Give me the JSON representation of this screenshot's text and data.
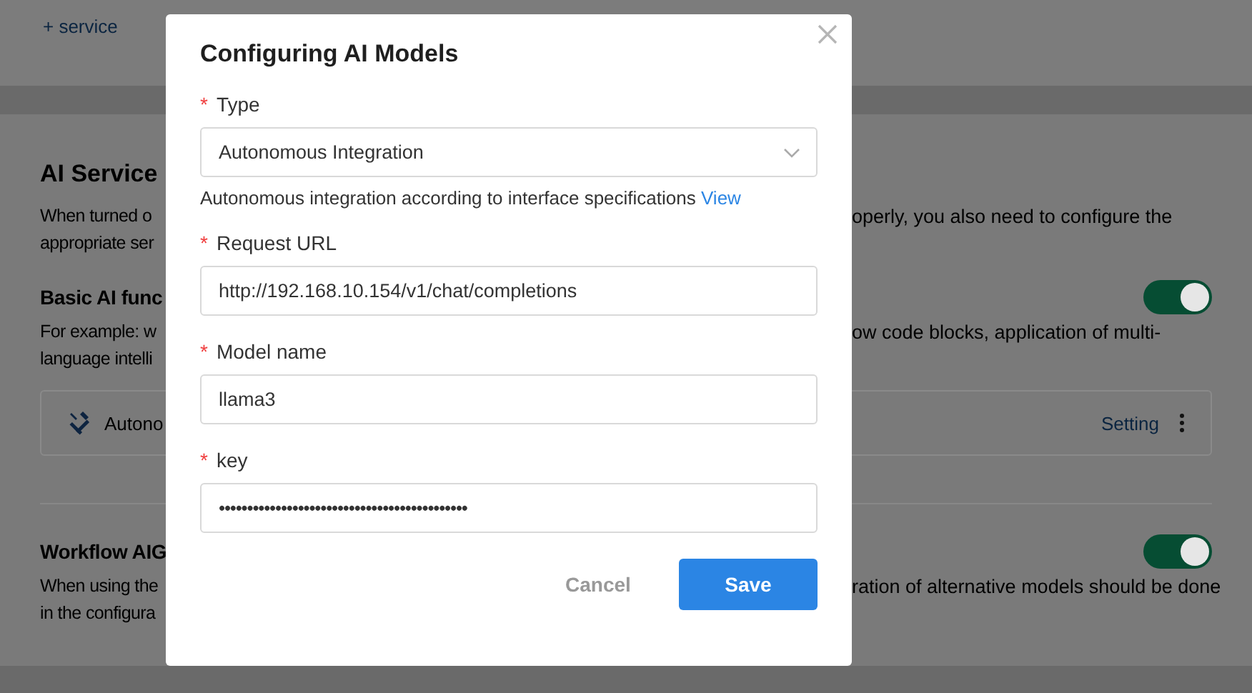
{
  "header": {
    "add_link": "+ service"
  },
  "section": {
    "title": "AI Service",
    "description_lines": [
      {
        "left": "When turned o",
        "right": "operly, you also need to configure the"
      },
      {
        "left": "appropriate ser"
      }
    ]
  },
  "features": [
    {
      "title": "Basic AI func",
      "on": true,
      "description_lines": [
        {
          "left": "For example: w",
          "right": "ow code blocks, application of multi-"
        },
        {
          "left": "language intelli"
        }
      ],
      "service": {
        "name": "Autono",
        "action": "Setting"
      }
    },
    {
      "title": "Workflow AIG",
      "on": true,
      "description_lines": [
        {
          "left": "When using the",
          "right": "ration of alternative models should be done"
        },
        {
          "left": "in the configura"
        }
      ]
    }
  ],
  "dialog": {
    "title": "Configuring AI Models",
    "fields": [
      {
        "kind": "select",
        "required_mark": "*",
        "label": "Type",
        "value": "Autonomous Integration",
        "help": "Autonomous integration according to interface specifications",
        "help_link": "View"
      },
      {
        "kind": "text",
        "required_mark": "*",
        "label": "Request URL",
        "value": "http://192.168.10.154/v1/chat/completions"
      },
      {
        "kind": "text",
        "required_mark": "*",
        "label": "Model name",
        "value": "llama3"
      },
      {
        "kind": "secret",
        "required_mark": "*",
        "label": "key",
        "value": "••••••••••••••••••••••••••••••••••••••••••••"
      }
    ],
    "buttons": [
      {
        "label": "Cancel",
        "kind": "secondary"
      },
      {
        "label": "Save",
        "kind": "primary"
      }
    ]
  }
}
